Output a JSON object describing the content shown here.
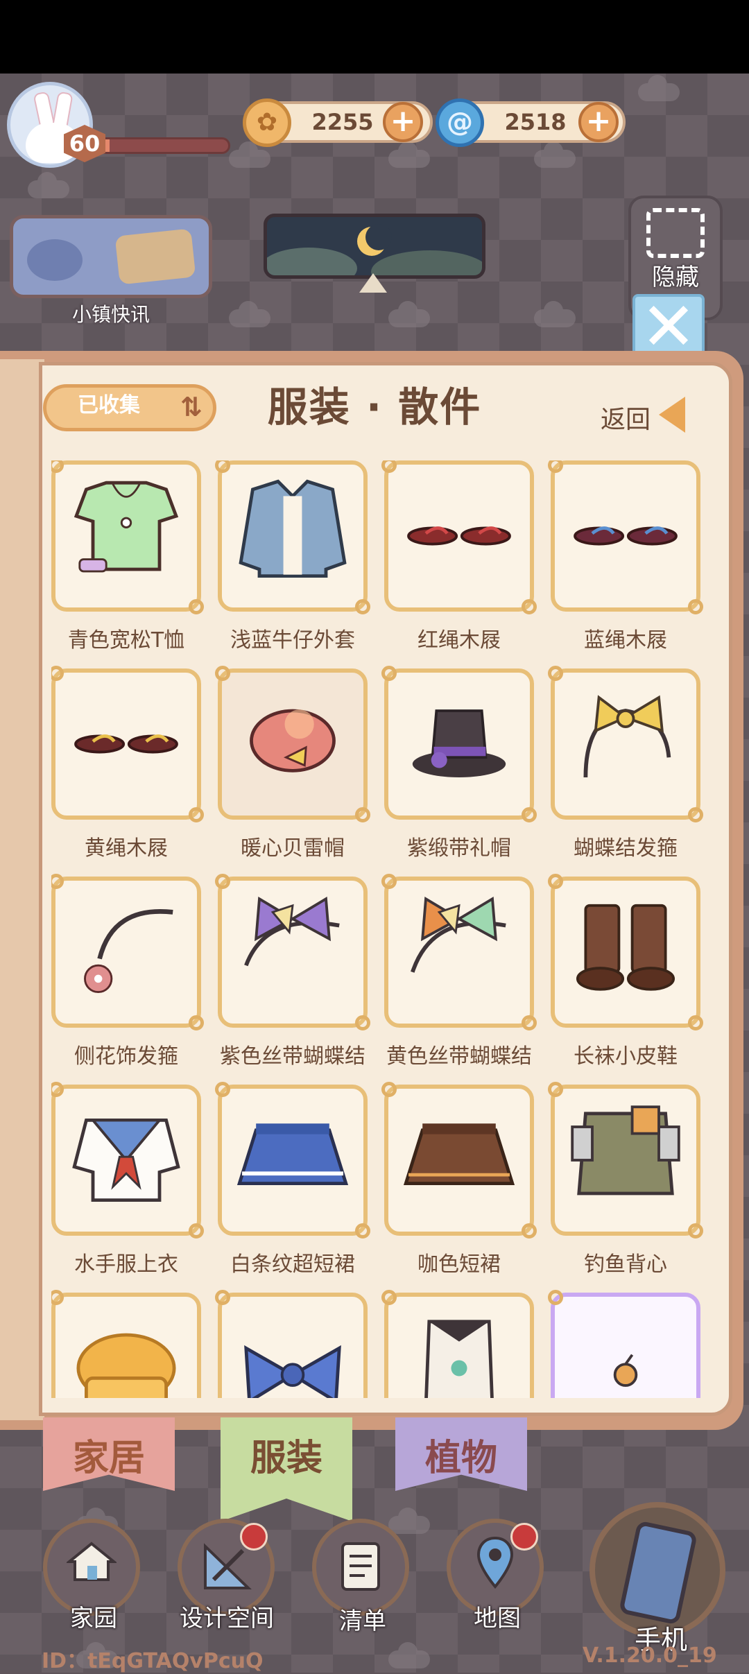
{
  "hud": {
    "level": "60",
    "xp_fraction": 0.08,
    "coins": "2255",
    "gems": "2518"
  },
  "news": {
    "label": "小镇快讯"
  },
  "hide": {
    "label": "隐藏"
  },
  "panel": {
    "sort_label": "已收集",
    "title": "服装 · 散件",
    "back_label": "返回"
  },
  "items": [
    {
      "name": "青色宽松T恤",
      "icon": "green-tshirt"
    },
    {
      "name": "浅蓝牛仔外套",
      "icon": "denim-jacket"
    },
    {
      "name": "红绳木屐",
      "icon": "red-clogs"
    },
    {
      "name": "蓝绳木屐",
      "icon": "blue-clogs"
    },
    {
      "name": "黄绳木屐",
      "icon": "yellow-clogs"
    },
    {
      "name": "暖心贝雷帽",
      "icon": "beret"
    },
    {
      "name": "紫缎带礼帽",
      "icon": "top-hat"
    },
    {
      "name": "蝴蝶结发箍",
      "icon": "bow-headband"
    },
    {
      "name": "侧花饰发箍",
      "icon": "flower-headband"
    },
    {
      "name": "紫色丝带蝴蝶结",
      "icon": "purple-ribbon"
    },
    {
      "name": "黄色丝带蝴蝶结",
      "icon": "yellow-ribbon"
    },
    {
      "name": "长袜小皮鞋",
      "icon": "socks-shoes"
    },
    {
      "name": "水手服上衣",
      "icon": "sailor-top"
    },
    {
      "name": "白条纹超短裙",
      "icon": "blue-skirt"
    },
    {
      "name": "咖色短裙",
      "icon": "brown-skirt"
    },
    {
      "name": "钓鱼背心",
      "icon": "fishing-vest"
    },
    {
      "name": "",
      "icon": "chef-hat"
    },
    {
      "name": "",
      "icon": "blue-bow"
    },
    {
      "name": "",
      "icon": "apron"
    },
    {
      "name": "",
      "icon": "bell-charm"
    }
  ],
  "categories": [
    {
      "label": "家居",
      "color": "#e6a39c"
    },
    {
      "label": "服装",
      "color": "#c7dca0"
    },
    {
      "label": "植物",
      "color": "#b7a6d8"
    }
  ],
  "nav": [
    {
      "label": "家园",
      "icon": "house-icon"
    },
    {
      "label": "设计空间",
      "icon": "design-icon"
    },
    {
      "label": "清单",
      "icon": "list-icon"
    },
    {
      "label": "地图",
      "icon": "map-pin-icon"
    },
    {
      "label": "手机",
      "icon": "phone-icon"
    }
  ],
  "footer": {
    "id": "ID：tEqGTAQvPcuQ",
    "version": "V.1.20.0_19"
  }
}
